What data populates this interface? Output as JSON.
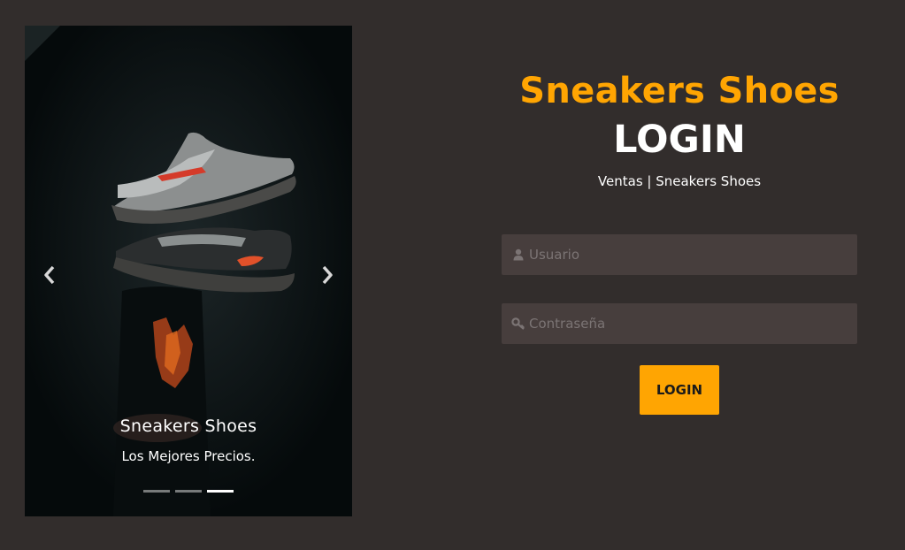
{
  "carousel": {
    "caption_title": "Sneakers Shoes",
    "caption_text": "Los Mejores Precios.",
    "prev_icon": "chevron-left-icon",
    "next_icon": "chevron-right-icon",
    "slide_count": 3,
    "active_slide": 3
  },
  "login": {
    "brand": "Sneakers Shoes",
    "title": "LOGIN",
    "subtitle": "Ventas | Sneakers Shoes",
    "username_placeholder": "Usuario",
    "username_icon": "user-icon",
    "password_placeholder": "Contraseña",
    "password_icon": "key-icon",
    "button_label": "LOGIN"
  },
  "colors": {
    "background": "#322d2c",
    "accent": "#ffa502",
    "input_background": "#473e3d"
  }
}
